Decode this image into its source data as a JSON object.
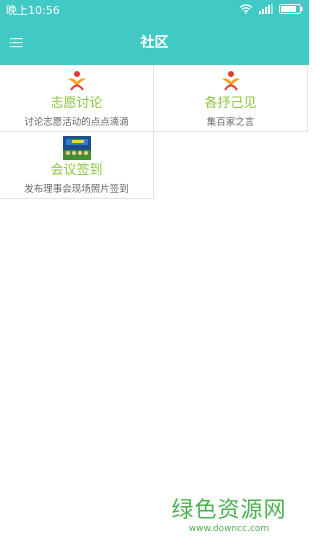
{
  "status_bar": {
    "time": "晚上10:56",
    "icons": [
      "wifi-icon",
      "signal-icon",
      "battery-icon"
    ]
  },
  "header": {
    "title": "社区",
    "menu_icon": "menu-icon",
    "background_color": "#40c9c5"
  },
  "tiles": [
    {
      "title": "志愿讨论",
      "subtitle": "讨论志愿活动的点点滴滴",
      "icon": "volunteer-logo-icon"
    },
    {
      "title": "各抒己见",
      "subtitle": "集百家之言",
      "icon": "volunteer-logo-icon"
    },
    {
      "title": "会议签到",
      "subtitle": "发布理事会现场照片签到",
      "icon": "meeting-photo-icon"
    }
  ],
  "accent_color": "#8cc63f",
  "watermark": {
    "title": "绿色资源网",
    "url": "www.downcc.com"
  }
}
